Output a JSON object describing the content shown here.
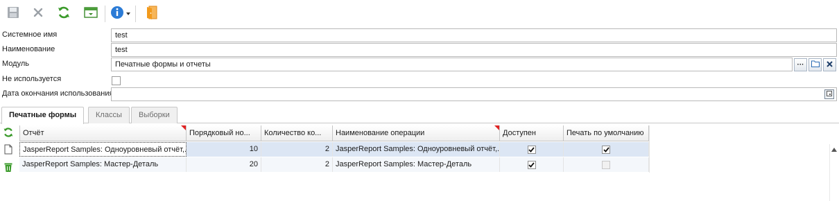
{
  "toolbar": {
    "buttons": [
      {
        "id": "save",
        "icon": "floppy-disk-icon"
      },
      {
        "id": "cancel",
        "icon": "close-icon"
      },
      {
        "id": "refresh",
        "icon": "refresh-icon"
      },
      {
        "id": "layout",
        "icon": "window-layout-icon"
      },
      {
        "id": "info",
        "icon": "info-icon"
      },
      {
        "id": "exit",
        "icon": "exit-door-icon"
      }
    ]
  },
  "form": {
    "system_name": {
      "label": "Системное имя",
      "value": "test"
    },
    "name": {
      "label": "Наименование",
      "value": "test"
    },
    "module": {
      "label": "Модуль",
      "value": "Печатные формы и отчеты",
      "select_label": "···"
    },
    "not_used": {
      "label": "Не используется",
      "checked": false
    },
    "end_date": {
      "label": "Дата окончания использования",
      "value": ""
    }
  },
  "tabs": [
    {
      "label": "Печатные формы",
      "active": true
    },
    {
      "label": "Классы",
      "active": false
    },
    {
      "label": "Выборки",
      "active": false
    }
  ],
  "grid": {
    "side_icons": [
      "refresh-icon",
      "new-document-icon",
      "trash-icon"
    ],
    "columns": [
      {
        "label": "Отчёт",
        "marker": true
      },
      {
        "label": "Порядковый но...",
        "marker": false
      },
      {
        "label": "Количество ко...",
        "marker": false
      },
      {
        "label": "Наименование операции",
        "marker": true
      },
      {
        "label": "Доступен",
        "marker": false
      },
      {
        "label": "Печать по умолчанию",
        "marker": false
      }
    ],
    "rows": [
      {
        "report": "JasperReport Samples: Одноуровневый отчёт,...",
        "order": "10",
        "count": "2",
        "operation": "JasperReport Samples: Одноуровневый отчёт,...",
        "available": true,
        "default_print": true,
        "default_print_enabled": true
      },
      {
        "report": "JasperReport Samples: Мастер-Деталь",
        "order": "20",
        "count": "2",
        "operation": "JasperReport Samples: Мастер-Деталь",
        "available": true,
        "default_print": false,
        "default_print_enabled": false
      }
    ]
  },
  "colors": {
    "accent": "#2b7bd6",
    "green": "#3a9a2a",
    "selection": "#dce6f4"
  }
}
